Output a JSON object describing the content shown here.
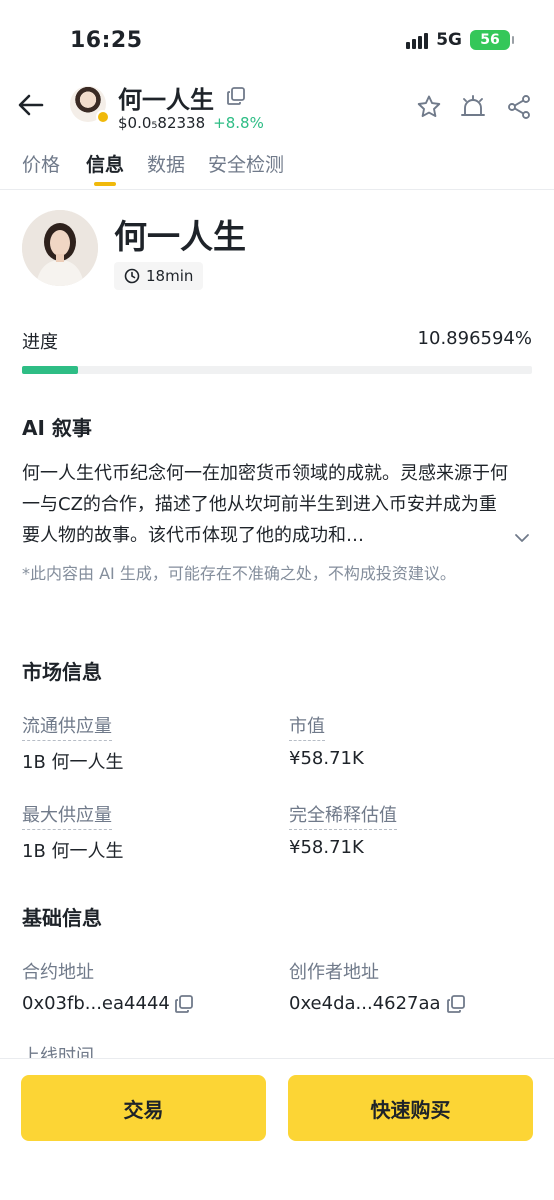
{
  "status_bar": {
    "time": "16:25",
    "network": "5G",
    "battery": "56"
  },
  "header": {
    "title": "何一人生",
    "price": "$0.0₅82338",
    "change": "+8.8%"
  },
  "tabs": [
    {
      "label": "价格"
    },
    {
      "label": "信息"
    },
    {
      "label": "数据"
    },
    {
      "label": "安全检测"
    }
  ],
  "profile": {
    "name": "何一人生",
    "age": "18min"
  },
  "progress": {
    "label": "进度",
    "value_text": "10.896594%",
    "percent": 10.896594
  },
  "ai": {
    "title": "AI 叙事",
    "text": "何一人生代币纪念何一在加密货币领域的成就。灵感来源于何一与CZ的合作，描述了他从坎坷前半生到进入币安并成为重要人物的故事。该代币体现了他的成功和…",
    "disclaimer": "*此内容由 AI 生成，可能存在不准确之处，不构成投资建议。"
  },
  "market": {
    "title": "市场信息",
    "circulating_label": "流通供应量",
    "circulating_value": "1B 何一人生",
    "market_cap_label": "市值",
    "market_cap_value": "¥58.71K",
    "max_supply_label": "最大供应量",
    "max_supply_value": "1B 何一人生",
    "fdv_label": "完全稀释估值",
    "fdv_value": "¥58.71K"
  },
  "basic": {
    "title": "基础信息",
    "contract_label": "合约地址",
    "contract_value": "0x03fb...ea4444",
    "creator_label": "创作者地址",
    "creator_value": "0xe4da...4627aa",
    "launch_label": "上线时间"
  },
  "actions": {
    "trade": "交易",
    "quick_buy": "快速购买"
  },
  "colors": {
    "accent": "#fcd535",
    "positive": "#2ebd85",
    "brand": "#f0b90b"
  }
}
